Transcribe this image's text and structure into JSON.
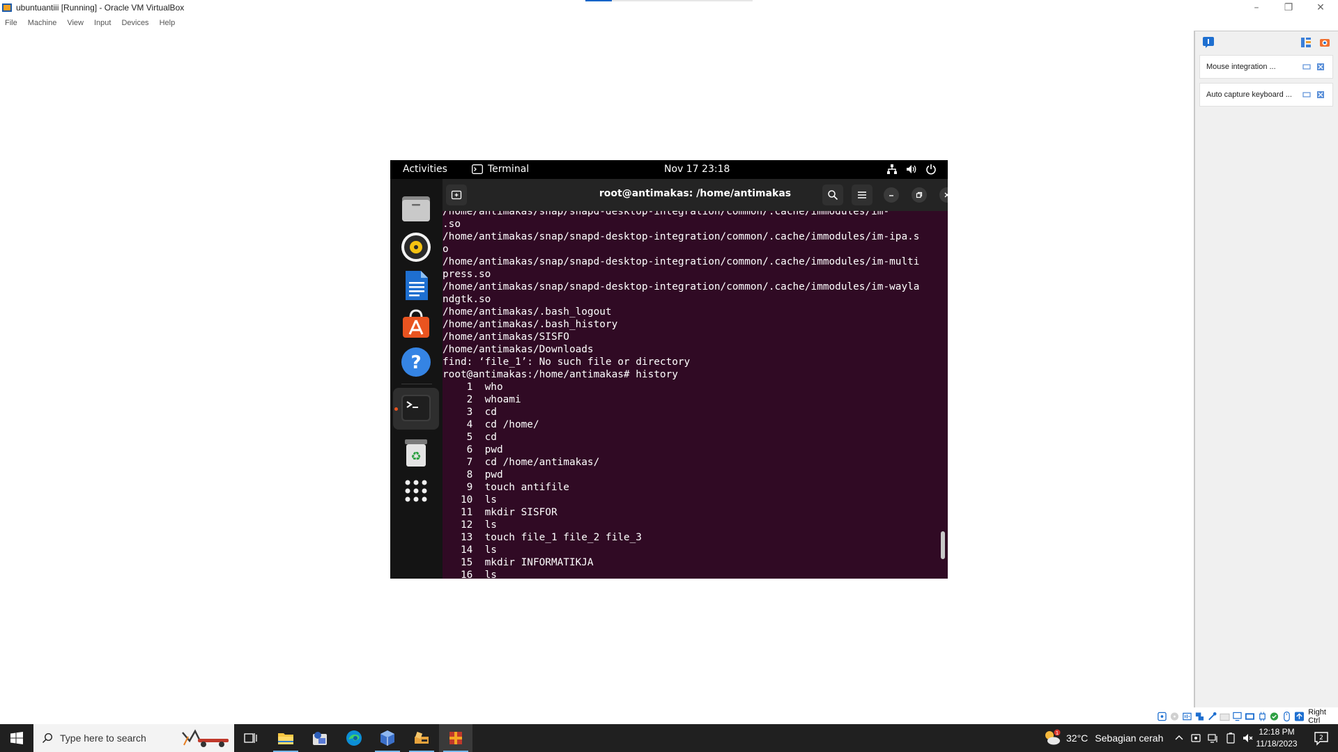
{
  "window": {
    "title": "ubuntuantiii [Running] - Oracle VM VirtualBox",
    "menu": [
      "File",
      "Machine",
      "View",
      "Input",
      "Devices",
      "Help"
    ],
    "progress_fraction": 0.16
  },
  "notifications": {
    "items": [
      {
        "text": "Mouse integration ..."
      },
      {
        "text": "Auto capture keyboard ..."
      }
    ]
  },
  "vm": {
    "topbar": {
      "activities": "Activities",
      "app_name": "Terminal",
      "clock": "Nov 17  23:18"
    },
    "dock": {
      "apps": [
        "files-icon",
        "rhythmbox-icon",
        "writer-icon",
        "app-center-icon",
        "help-icon",
        "terminal-icon",
        "trash-icon",
        "show-apps-icon"
      ]
    },
    "terminal": {
      "title": "root@antimakas: /home/antimakas",
      "lines": [
        "/home/antimakas/snap/snapd-desktop-integration/common/.cache/immodules/im-",
        ".so",
        "/home/antimakas/snap/snapd-desktop-integration/common/.cache/immodules/im-ipa.s",
        "o",
        "/home/antimakas/snap/snapd-desktop-integration/common/.cache/immodules/im-multi",
        "press.so",
        "/home/antimakas/snap/snapd-desktop-integration/common/.cache/immodules/im-wayla",
        "ndgtk.so",
        "/home/antimakas/.bash_logout",
        "/home/antimakas/.bash_history",
        "/home/antimakas/SISFO",
        "/home/antimakas/Downloads",
        "find: ‘file_1’: No such file or directory",
        "root@antimakas:/home/antimakas# history",
        "    1  who",
        "    2  whoami",
        "    3  cd",
        "    4  cd /home/",
        "    5  cd",
        "    6  pwd",
        "    7  cd /home/antimakas/",
        "    8  pwd",
        "    9  touch antifile",
        "   10  ls",
        "   11  mkdir SISFOR",
        "   12  ls",
        "   13  touch file_1 file_2 file_3",
        "   14  ls",
        "   15  mkdir INFORMATIKJA",
        "   16  ls"
      ]
    }
  },
  "statusbar": {
    "host_key": "Right Ctrl"
  },
  "taskbar": {
    "search_placeholder": "Type here to search",
    "weather_temp": "32°C",
    "weather_desc": "Sebagian cerah",
    "weather_badge": "1",
    "time": "12:18 PM",
    "date": "11/18/2023",
    "notification_count": "2"
  },
  "colors": {
    "terminal_bg": "#300a24",
    "header_bg": "#242424",
    "taskbar_bg": "#202020",
    "accent": "#e95420"
  }
}
